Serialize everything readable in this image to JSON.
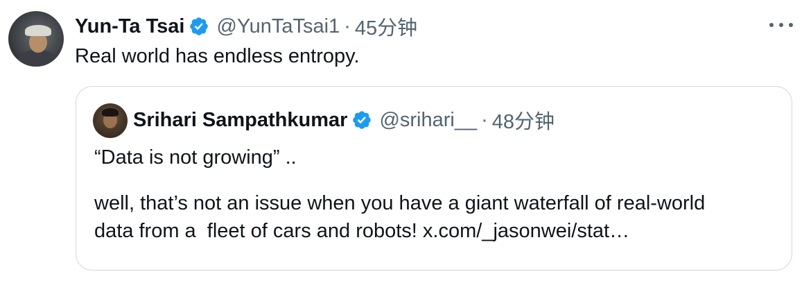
{
  "tweet": {
    "author_name": "Yun-Ta Tsai",
    "handle": "@YunTaTsai1",
    "separator": "·",
    "time": "45分钟",
    "text": "Real world has endless entropy."
  },
  "quoted": {
    "author_name": "Srihari Sampathkumar",
    "handle": "@srihari__",
    "separator": "·",
    "time": "48分钟",
    "lines": [
      "“Data is not growing” ..",
      "well, that’s not an issue when you have a giant waterfall of real-world",
      "data from a  fleet of cars and robots! x.com/_jasonwei/stat…"
    ]
  },
  "icons": {
    "verified": "verified-badge-icon",
    "more": "more-options-icon"
  },
  "colors": {
    "verified_blue": "#1d9bf0",
    "secondary_text": "#536471",
    "border": "#cfd9de"
  }
}
